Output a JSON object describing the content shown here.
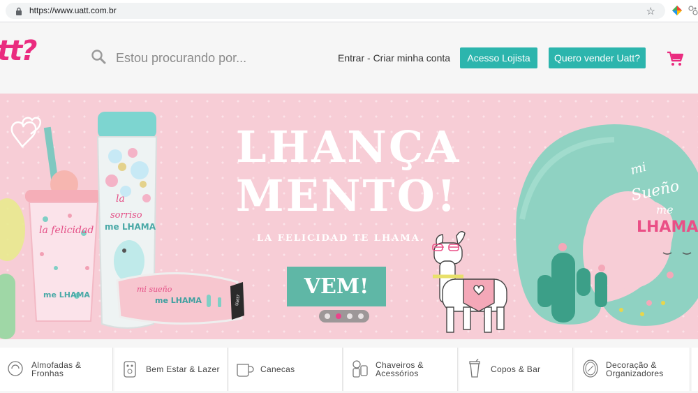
{
  "browser": {
    "url_host": "https://www.uatt.com.br"
  },
  "header": {
    "logo_text": "tt?",
    "search_placeholder": "Estou procurando por...",
    "login_link": "Entrar - Criar minha conta",
    "btn_lojista": "Acesso Lojista",
    "btn_vender": "Quero vender Uatt?"
  },
  "banner": {
    "headline_line1": "LHANÇA",
    "headline_line2": "MENTO!",
    "tagline": "LA FELICIDAD TE LHAMA.",
    "cta": "VEM!",
    "cup_text1": "la felicidad",
    "cup_text2": "me LHAMA",
    "bottle_text1": "la",
    "bottle_text2": "sorriso",
    "bottle_text3": "me LHAMA",
    "mask_text1": "mi sueño",
    "mask_text2": "me LHAMA",
    "mask_tag": "Uatt?",
    "pillow_text1": "mi",
    "pillow_text2": "Sueño",
    "pillow_text3": "me",
    "pillow_text4": "LHAMA",
    "carousel_active_index": 1,
    "carousel_count": 4
  },
  "categories": [
    {
      "line1": "Almofadas &",
      "line2": "Fronhas",
      "icon": "pillow-icon"
    },
    {
      "line1": "Bem Estar & Lazer",
      "line2": "",
      "icon": "wellness-icon"
    },
    {
      "line1": "Canecas",
      "line2": "",
      "icon": "mug-icon"
    },
    {
      "line1": "Chaveiros &",
      "line2": "Acessórios",
      "icon": "keychain-icon"
    },
    {
      "line1": "Copos & Bar",
      "line2": "",
      "icon": "cup-icon"
    },
    {
      "line1": "Decoração &",
      "line2": "Organizadores",
      "icon": "decor-icon"
    }
  ],
  "colors": {
    "brand_pink": "#ea2b7f",
    "teal": "#2cb5ad",
    "banner_bg": "#f7cdd6",
    "cta_green": "#5fb7a6"
  }
}
